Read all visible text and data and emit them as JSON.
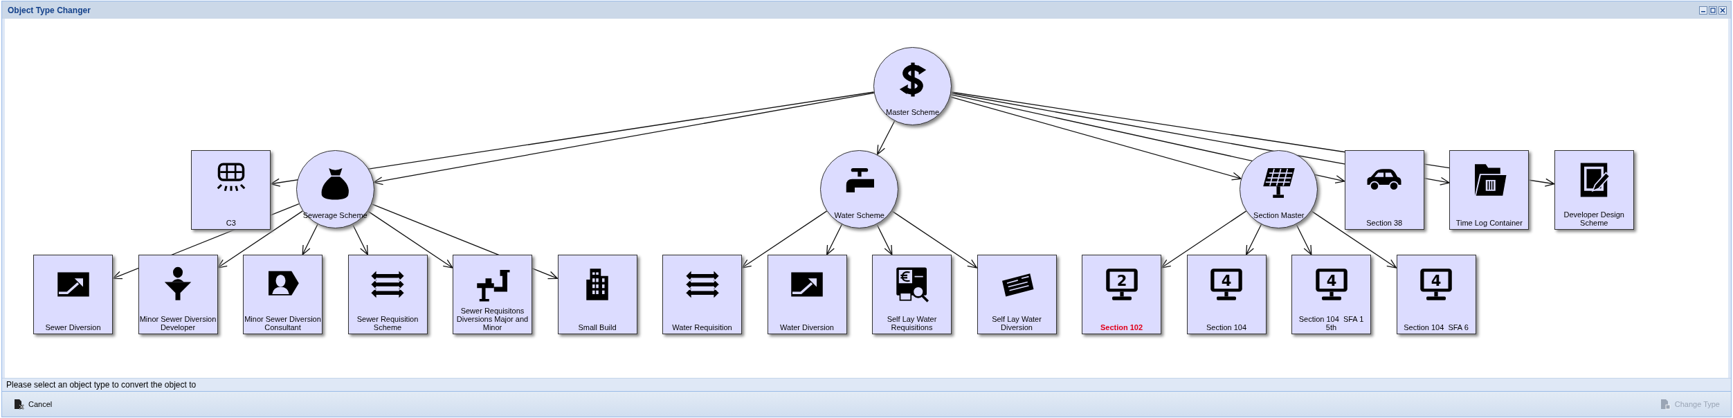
{
  "window": {
    "title": "Object Type Changer"
  },
  "tree": {
    "label": "Master Scheme",
    "kind": "circle",
    "current": false,
    "children": [
      {
        "label": "C3",
        "kind": "box",
        "current": false
      },
      {
        "label": "Sewerage Scheme",
        "kind": "circle",
        "current": false,
        "children": [
          {
            "label": "Sewer Diversion",
            "kind": "box",
            "current": false
          },
          {
            "label": "Minor Sewer Diversion Developer",
            "kind": "box",
            "current": false
          },
          {
            "label": "Minor Sewer Diversion Consultant",
            "kind": "box",
            "current": false
          },
          {
            "label": "Sewer Requisition Scheme",
            "kind": "box",
            "current": false
          },
          {
            "label": "Sewer Requisitons Diversions Major and Minor",
            "kind": "box",
            "current": false
          },
          {
            "label": "Small Build",
            "kind": "box",
            "current": false
          }
        ]
      },
      {
        "label": "Water Scheme",
        "kind": "circle",
        "current": false,
        "children": [
          {
            "label": "Water Requisition",
            "kind": "box",
            "current": false
          },
          {
            "label": "Water Diversion",
            "kind": "box",
            "current": false
          },
          {
            "label": "Self Lay Water Requisitions",
            "kind": "box",
            "current": false
          },
          {
            "label": "Self Lay Water Diversion",
            "kind": "box",
            "current": false
          }
        ]
      },
      {
        "label": "Section Master",
        "kind": "circle",
        "current": false,
        "children": [
          {
            "label": "Section 102",
            "kind": "box",
            "current": true,
            "badge": "2"
          },
          {
            "label": "Section 104",
            "kind": "box",
            "current": false,
            "badge": "4"
          },
          {
            "label": "Section 104  SFA 1 5th",
            "kind": "box",
            "current": false,
            "badge": "4"
          },
          {
            "label": "Section 104  SFA 6",
            "kind": "box",
            "current": false,
            "badge": "4"
          }
        ]
      },
      {
        "label": "Section 38",
        "kind": "box",
        "current": false
      },
      {
        "label": "Time Log Container",
        "kind": "box",
        "current": false
      },
      {
        "label": "Developer Design Scheme",
        "kind": "box",
        "current": false
      }
    ]
  },
  "status_text": "Please select an object type to convert the object to",
  "buttons": [
    {
      "label": "Cancel",
      "disabled": false
    },
    {
      "label": "Change Type",
      "disabled": true
    }
  ]
}
